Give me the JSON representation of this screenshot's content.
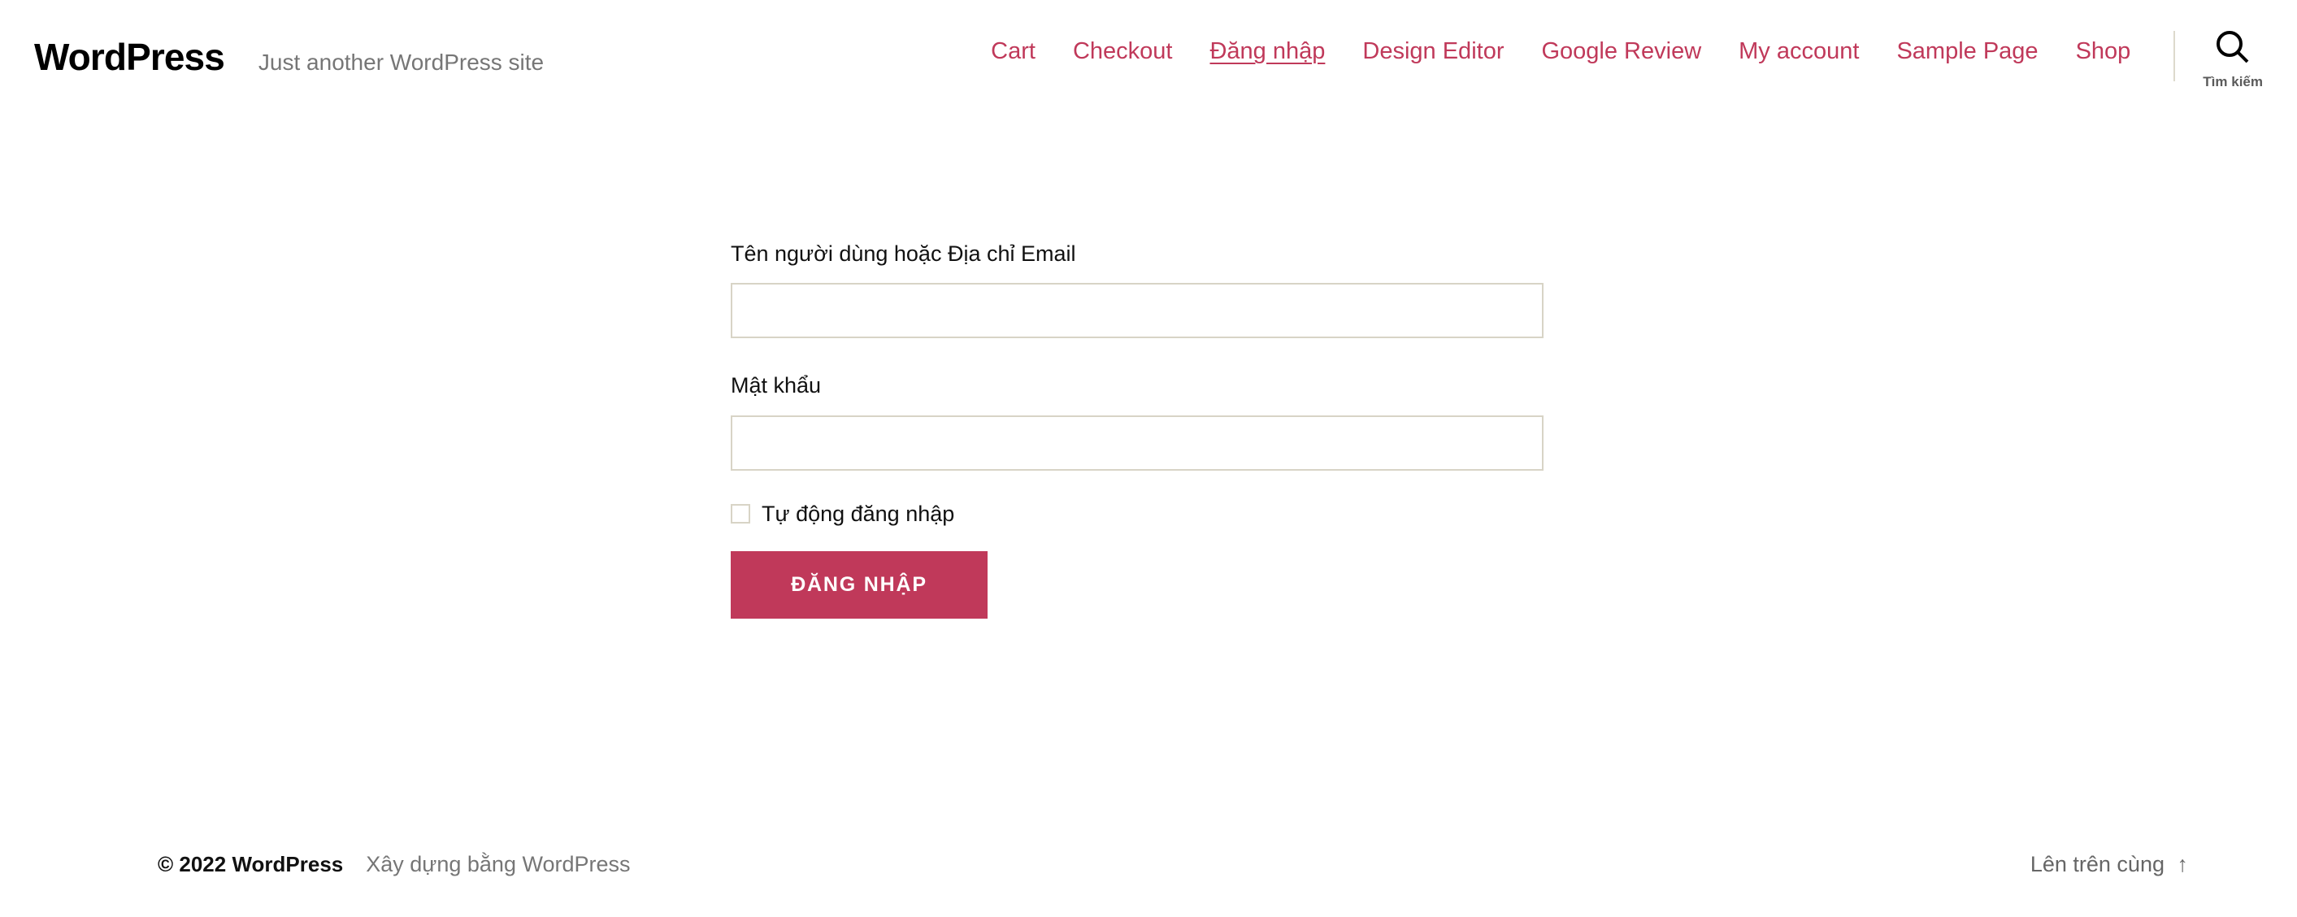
{
  "header": {
    "site_title": "WordPress",
    "tagline": "Just another WordPress site",
    "nav": [
      {
        "label": "Cart",
        "current": false
      },
      {
        "label": "Checkout",
        "current": false
      },
      {
        "label": "Đăng nhập",
        "current": true
      },
      {
        "label": "Design Editor",
        "current": false
      },
      {
        "label": "Google Review",
        "current": false
      },
      {
        "label": "My account",
        "current": false
      },
      {
        "label": "Sample Page",
        "current": false
      },
      {
        "label": "Shop",
        "current": false
      }
    ],
    "search": {
      "icon": "search-icon",
      "label": "Tìm kiếm"
    }
  },
  "main": {
    "form": {
      "username": {
        "label": "Tên người dùng hoặc Địa chỉ Email",
        "value": "",
        "placeholder": ""
      },
      "password": {
        "label": "Mật khẩu",
        "value": "",
        "placeholder": ""
      },
      "remember": {
        "label": "Tự động đăng nhập",
        "checked": false
      },
      "submit_label": "Đăng nhập"
    }
  },
  "footer": {
    "copyright": "© 2022 WordPress",
    "credit": "Xây dựng bằng WordPress",
    "to_top": "Lên trên cùng",
    "to_top_arrow": "↑"
  },
  "colors": {
    "accent": "#c0395a",
    "border": "#d8d4c6",
    "muted_text": "#767676",
    "text": "#111111",
    "background": "#ffffff"
  }
}
